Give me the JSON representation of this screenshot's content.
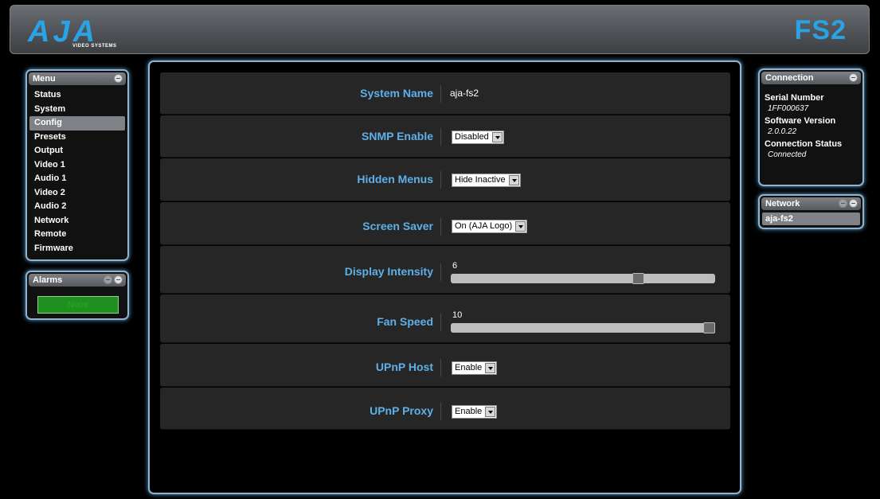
{
  "header": {
    "logo_text": "AJA",
    "logo_sub": "VIDEO SYSTEMS",
    "product": "FS2"
  },
  "menu": {
    "title": "Menu",
    "items": [
      "Status",
      "System",
      "Config",
      "Presets",
      "Output",
      "Video 1",
      "Audio 1",
      "Video 2",
      "Audio 2",
      "Network",
      "Remote",
      "Firmware"
    ],
    "active": "Config"
  },
  "alarms": {
    "title": "Alarms",
    "status": "None"
  },
  "connection": {
    "title": "Connection",
    "serial_label": "Serial Number",
    "serial_value": "1FF000637",
    "software_label": "Software Version",
    "software_value": "2.0.0.22",
    "status_label": "Connection Status",
    "status_value": "Connected"
  },
  "network": {
    "title": "Network",
    "item": "aja-fs2"
  },
  "config": {
    "system_name_label": "System Name",
    "system_name_value": "aja-fs2",
    "snmp_label": "SNMP Enable",
    "snmp_value": "Disabled",
    "hidden_label": "Hidden Menus",
    "hidden_value": "Hide Inactive",
    "saver_label": "Screen Saver",
    "saver_value": "On (AJA Logo)",
    "intensity_label": "Display Intensity",
    "intensity_value": "6",
    "intensity_fraction": 0.72,
    "fan_label": "Fan Speed",
    "fan_value": "10",
    "fan_fraction": 1.0,
    "upnp_host_label": "UPnP Host",
    "upnp_host_value": "Enable",
    "upnp_proxy_label": "UPnP Proxy",
    "upnp_proxy_value": "Enable"
  },
  "colors": {
    "accent": "#2aa3e6",
    "label_blue": "#5fb0e8",
    "alarm_green": "#1f8f1f"
  }
}
